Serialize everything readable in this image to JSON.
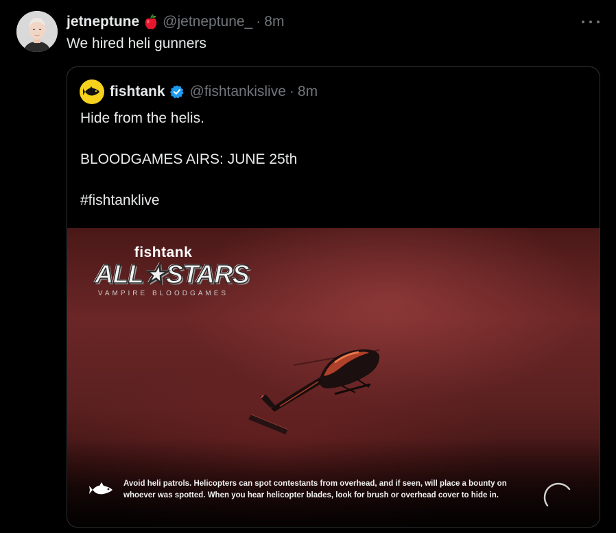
{
  "tweet": {
    "display_name": "jetneptune",
    "handle": "@jetneptune_",
    "separator": "·",
    "time": "8m",
    "text": "We hired heli gunners",
    "badge_icon": "apple-icon"
  },
  "quote": {
    "display_name": "fishtank",
    "handle": "@fishtankislive",
    "separator": "·",
    "time": "8m",
    "verified": true,
    "lines": [
      "Hide from the helis.",
      "BLOODGAMES AIRS: JUNE 25th",
      "#fishtanklive"
    ],
    "media": {
      "logo_brand": "fishtank",
      "logo_title": "ALL★STARS",
      "logo_subtitle": "VAMPIRE BLOODGAMES",
      "caption": "Avoid heli patrols. Helicopters can spot contestants from overhead, and if seen, will place a bounty on whoever was spotted. When you hear helicopter blades, look for brush or overhead cover to hide in.",
      "loading": true
    }
  },
  "colors": {
    "background": "#000000",
    "text": "#e7e9ea",
    "muted": "#71767b",
    "border": "#2f3336",
    "verified": "#1d9bf0",
    "fishtank_yellow": "#f7d21d"
  }
}
